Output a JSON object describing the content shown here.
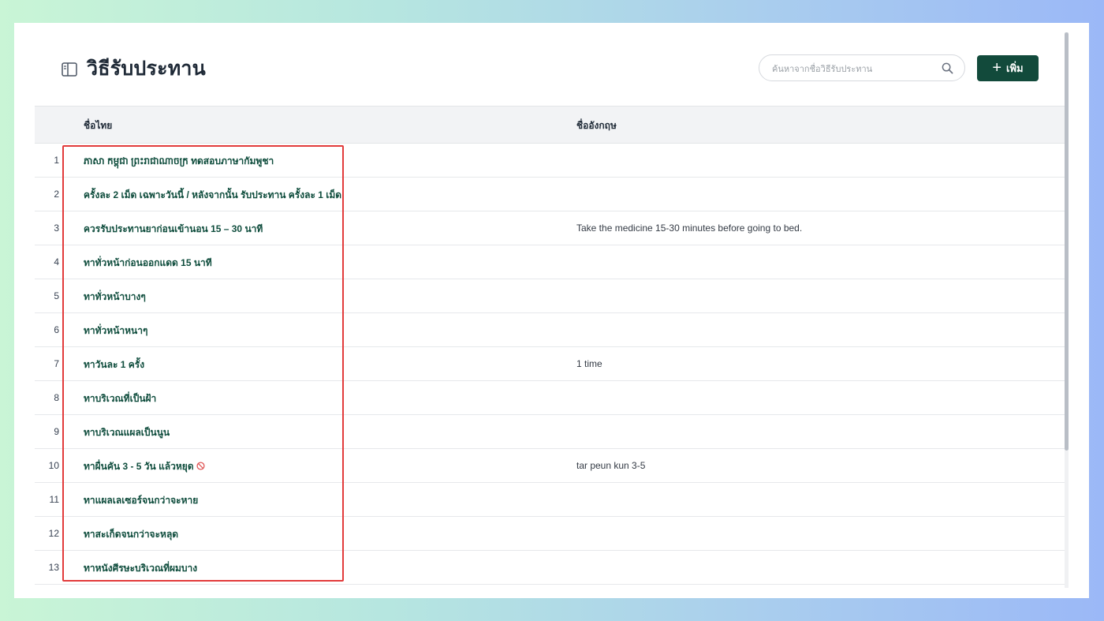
{
  "header": {
    "title": "วิธีรับประทาน",
    "search_placeholder": "ค้นหาจากชื่อวิธีรับประทาน",
    "add_label": "เพิ่ม"
  },
  "table": {
    "columns": {
      "thai": "ชื่อไทย",
      "english": "ชื่ออังกฤษ"
    },
    "rows": [
      {
        "num": "1",
        "thai": "ភាសា កម្ពុជា ព្រះរាជាណាចក្រ ทดสอบภาษากัมพูชา",
        "english": ""
      },
      {
        "num": "2",
        "thai": "ครั้งละ 2 เม็ด เฉพาะวันนี้ / หลังจากนั้น รับประทาน ครั้งละ 1 เม็ด",
        "english": ""
      },
      {
        "num": "3",
        "thai": "ควรรับประทานยาก่อนเข้านอน 15 – 30 นาที",
        "english": "Take the medicine 15-30 minutes before going to bed."
      },
      {
        "num": "4",
        "thai": "ทาทั่วหน้าก่อนออกแดด 15 นาที",
        "english": ""
      },
      {
        "num": "5",
        "thai": "ทาทั่วหน้าบางๆ",
        "english": ""
      },
      {
        "num": "6",
        "thai": "ทาทั่วหน้าหนาๆ",
        "english": ""
      },
      {
        "num": "7",
        "thai": "ทาวันละ 1 ครั้ง",
        "english": "1 time"
      },
      {
        "num": "8",
        "thai": "ทาบริเวณที่เป็นฝ้า",
        "english": ""
      },
      {
        "num": "9",
        "thai": "ทาบริเวณแผลเป็นนูน",
        "english": ""
      },
      {
        "num": "10",
        "thai": "ทาผื่นคัน 3 - 5 วัน แล้วหยุด",
        "english": "tar peun kun 3-5",
        "icon": "ban-icon"
      },
      {
        "num": "11",
        "thai": "ทาแผลเลเซอร์จนกว่าจะหาย",
        "english": ""
      },
      {
        "num": "12",
        "thai": "ทาสะเก็ดจนกว่าจะหลุด",
        "english": ""
      },
      {
        "num": "13",
        "thai": "ทาหนังศีรษะบริเวณที่ผมบาง",
        "english": ""
      }
    ]
  },
  "colors": {
    "accent": "#124a3b",
    "highlight": "#e23b3b",
    "row_text": "#0f4d3d"
  }
}
